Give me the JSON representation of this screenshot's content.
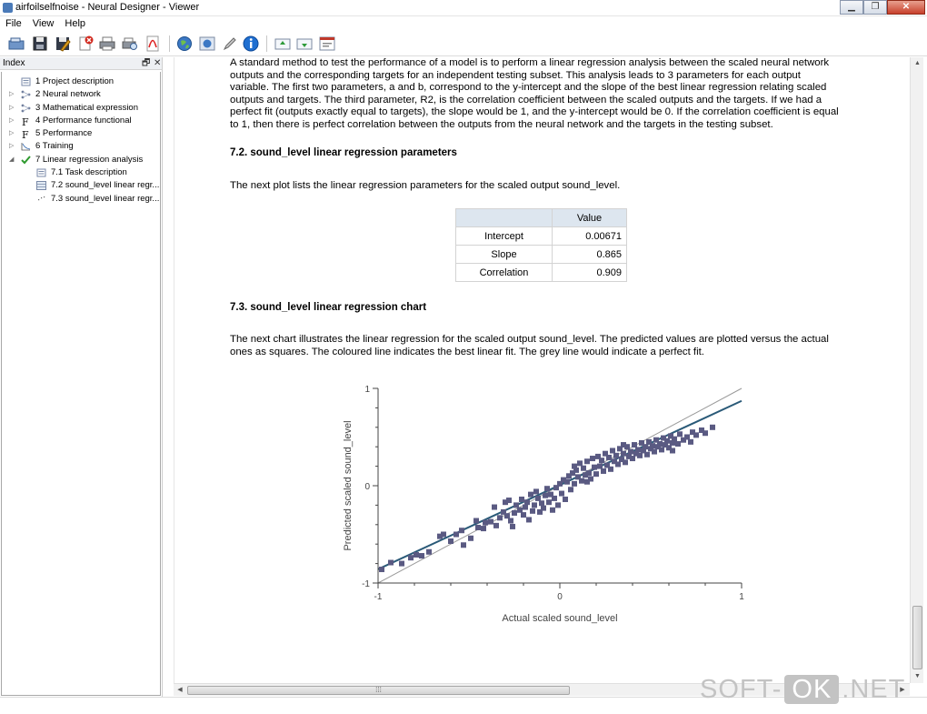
{
  "window": {
    "title": "airfoilselfnoise - Neural Designer - Viewer",
    "min_glyph": "▁",
    "max_glyph": "❐",
    "close_glyph": "✕"
  },
  "menu": [
    "File",
    "View",
    "Help"
  ],
  "toolbar": {
    "buttons": [
      "open-icon",
      "save-icon",
      "save-as-icon",
      "close-file-icon",
      "print-icon",
      "print-preview-icon",
      "export-pdf-icon",
      "web-icon",
      "globe-icon",
      "edit-icon",
      "info-icon",
      "move-up-icon",
      "move-down-icon",
      "viewer-icon"
    ]
  },
  "index": {
    "title": "Index",
    "float_glyph": "🗗",
    "close_glyph": "✕",
    "items": [
      {
        "label": "1 Project description",
        "icon": "document-icon",
        "level": 0,
        "expander": ""
      },
      {
        "label": "2 Neural network",
        "icon": "network-icon",
        "level": 0,
        "expander": "▷"
      },
      {
        "label": "3 Mathematical expression",
        "icon": "network-icon",
        "level": 0,
        "expander": "▷"
      },
      {
        "label": "4 Performance functional",
        "icon": "function-icon",
        "level": 0,
        "expander": "▷"
      },
      {
        "label": "5 Performance",
        "icon": "function-icon",
        "level": 0,
        "expander": "▷"
      },
      {
        "label": "6 Training",
        "icon": "training-icon",
        "level": 0,
        "expander": "▷"
      },
      {
        "label": "7 Linear regression analysis",
        "icon": "check-icon",
        "level": 0,
        "expander": "◢"
      },
      {
        "label": "7.1 Task description",
        "icon": "document-icon",
        "level": 1,
        "expander": ""
      },
      {
        "label": "7.2 sound_level linear regr...",
        "icon": "table-icon",
        "level": 1,
        "expander": ""
      },
      {
        "label": "7.3 sound_level linear regr...",
        "icon": "chart-icon",
        "level": 1,
        "expander": ""
      }
    ]
  },
  "content": {
    "intro_lines": [
      "A standard method to test the performance of a model is to perform a linear regression analysis between the scaled neural network",
      "outputs and the corresponding targets for an independent testing subset. This analysis leads to 3 parameters for each output",
      "variable. The first two parameters, a and b, correspond to the y-intercept and the slope of the best linear regression relating scaled",
      "outputs and targets. The third parameter, R2, is the correlation coefficient between the scaled outputs and the targets. If we had a",
      "perfect fit (outputs exactly equal to targets), the slope would be 1, and the y-intercept would be 0. If the correlation coefficient is equal",
      "to 1, then there is perfect correlation between the outputs from the neural network and the targets in the testing subset."
    ],
    "section_params_title": "7.2. sound_level linear regression parameters",
    "section_params_text": "The next plot lists the linear regression parameters for the scaled output sound_level.",
    "table": {
      "header": [
        "",
        "Value"
      ],
      "rows": [
        {
          "label": "Intercept",
          "value": "0.00671"
        },
        {
          "label": "Slope",
          "value": "0.865"
        },
        {
          "label": "Correlation",
          "value": "0.909"
        }
      ]
    },
    "section_chart_title": "7.3. sound_level linear regression chart",
    "section_chart_lines": [
      "The next chart illustrates the linear regression for the scaled output sound_level. The predicted values are plotted versus the actual",
      "ones as squares. The coloured line indicates the best linear fit. The grey line would indicate a perfect fit."
    ]
  },
  "chart_data": {
    "type": "scatter",
    "xlabel": "Actual scaled sound_level",
    "ylabel": "Predicted scaled sound_level",
    "xlim": [
      -1,
      1
    ],
    "ylim": [
      -1,
      1
    ],
    "xticks": [
      "-1",
      "0",
      "1"
    ],
    "yticks": [
      "-1",
      "0",
      "1"
    ],
    "grid": false,
    "colors": {
      "points": "#5a5a82",
      "fit": "#2a5a78",
      "perfect": "#9a9a9a"
    },
    "lines": [
      {
        "role": "best linear fit",
        "intercept": 0.00671,
        "slope": 0.865
      },
      {
        "role": "perfect fit",
        "intercept": 0,
        "slope": 1
      }
    ],
    "points": [
      [
        -0.98,
        -0.86
      ],
      [
        -0.93,
        -0.79
      ],
      [
        -0.87,
        -0.8
      ],
      [
        -0.82,
        -0.74
      ],
      [
        -0.79,
        -0.71
      ],
      [
        -0.76,
        -0.72
      ],
      [
        -0.72,
        -0.68
      ],
      [
        -0.66,
        -0.52
      ],
      [
        -0.64,
        -0.5
      ],
      [
        -0.6,
        -0.57
      ],
      [
        -0.57,
        -0.5
      ],
      [
        -0.54,
        -0.46
      ],
      [
        -0.53,
        -0.61
      ],
      [
        -0.49,
        -0.54
      ],
      [
        -0.45,
        -0.43
      ],
      [
        -0.42,
        -0.44
      ],
      [
        -0.41,
        -0.38
      ],
      [
        -0.38,
        -0.37
      ],
      [
        -0.36,
        -0.22
      ],
      [
        -0.35,
        -0.41
      ],
      [
        -0.33,
        -0.33
      ],
      [
        -0.31,
        -0.27
      ],
      [
        -0.29,
        -0.31
      ],
      [
        -0.28,
        -0.15
      ],
      [
        -0.27,
        -0.36
      ],
      [
        -0.25,
        -0.28
      ],
      [
        -0.24,
        -0.2
      ],
      [
        -0.22,
        -0.25
      ],
      [
        -0.21,
        -0.14
      ],
      [
        -0.2,
        -0.3
      ],
      [
        -0.19,
        -0.22
      ],
      [
        -0.18,
        -0.17
      ],
      [
        -0.17,
        -0.35
      ],
      [
        -0.16,
        -0.09
      ],
      [
        -0.15,
        -0.26
      ],
      [
        -0.14,
        -0.2
      ],
      [
        -0.13,
        -0.06
      ],
      [
        -0.12,
        -0.13
      ],
      [
        -0.11,
        -0.27
      ],
      [
        -0.1,
        -0.18
      ],
      [
        -0.09,
        -0.23
      ],
      [
        -0.08,
        -0.1
      ],
      [
        -0.07,
        -0.03
      ],
      [
        -0.06,
        -0.17
      ],
      [
        -0.05,
        -0.09
      ],
      [
        -0.04,
        -0.25
      ],
      [
        -0.03,
        -0.13
      ],
      [
        -0.02,
        -0.02
      ],
      [
        -0.01,
        -0.2
      ],
      [
        0,
        0.02
      ],
      [
        0.01,
        -0.08
      ],
      [
        0.02,
        0.06
      ],
      [
        0.03,
        -0.14
      ],
      [
        0.04,
        0.04
      ],
      [
        0.05,
        0.1
      ],
      [
        0.06,
        -0.04
      ],
      [
        0.07,
        0.13
      ],
      [
        0.08,
        0.02
      ],
      [
        0.09,
        0.16
      ],
      [
        0.1,
        0.09
      ],
      [
        0.11,
        0.23
      ],
      [
        0.12,
        0.05
      ],
      [
        0.13,
        0.18
      ],
      [
        0.14,
        0.11
      ],
      [
        0.15,
        0.25
      ],
      [
        0.16,
        0.13
      ],
      [
        0.17,
        0.07
      ],
      [
        0.18,
        0.28
      ],
      [
        0.19,
        0.19
      ],
      [
        0.2,
        0.12
      ],
      [
        0.21,
        0.3
      ],
      [
        0.22,
        0.2
      ],
      [
        0.23,
        0.26
      ],
      [
        0.24,
        0.15
      ],
      [
        0.25,
        0.33
      ],
      [
        0.26,
        0.21
      ],
      [
        0.27,
        0.29
      ],
      [
        0.28,
        0.17
      ],
      [
        0.29,
        0.36
      ],
      [
        0.3,
        0.25
      ],
      [
        0.31,
        0.31
      ],
      [
        0.32,
        0.22
      ],
      [
        0.33,
        0.38
      ],
      [
        0.34,
        0.27
      ],
      [
        0.35,
        0.33
      ],
      [
        0.36,
        0.24
      ],
      [
        0.37,
        0.4
      ],
      [
        0.38,
        0.3
      ],
      [
        0.39,
        0.35
      ],
      [
        0.4,
        0.28
      ],
      [
        0.41,
        0.42
      ],
      [
        0.42,
        0.33
      ],
      [
        0.43,
        0.37
      ],
      [
        0.44,
        0.31
      ],
      [
        0.45,
        0.44
      ],
      [
        0.46,
        0.36
      ],
      [
        0.47,
        0.4
      ],
      [
        0.48,
        0.32
      ],
      [
        0.49,
        0.45
      ],
      [
        0.5,
        0.38
      ],
      [
        0.51,
        0.41
      ],
      [
        0.52,
        0.35
      ],
      [
        0.53,
        0.47
      ],
      [
        0.54,
        0.4
      ],
      [
        0.55,
        0.43
      ],
      [
        0.56,
        0.37
      ],
      [
        0.57,
        0.49
      ],
      [
        0.58,
        0.42
      ],
      [
        0.59,
        0.46
      ],
      [
        0.6,
        0.39
      ],
      [
        0.61,
        0.51
      ],
      [
        0.62,
        0.44
      ],
      [
        0.63,
        0.48
      ],
      [
        0.65,
        0.43
      ],
      [
        0.66,
        0.53
      ],
      [
        0.68,
        0.47
      ],
      [
        0.7,
        0.5
      ],
      [
        0.72,
        0.45
      ],
      [
        0.73,
        0.55
      ],
      [
        0.75,
        0.52
      ],
      [
        0.78,
        0.57
      ],
      [
        0.8,
        0.54
      ],
      [
        0.84,
        0.6
      ],
      [
        -0.3,
        -0.17
      ],
      [
        -0.46,
        -0.36
      ],
      [
        -0.26,
        -0.42
      ],
      [
        0.08,
        0.2
      ],
      [
        0.15,
        0.04
      ],
      [
        0.35,
        0.42
      ],
      [
        0.62,
        0.36
      ]
    ]
  }
}
